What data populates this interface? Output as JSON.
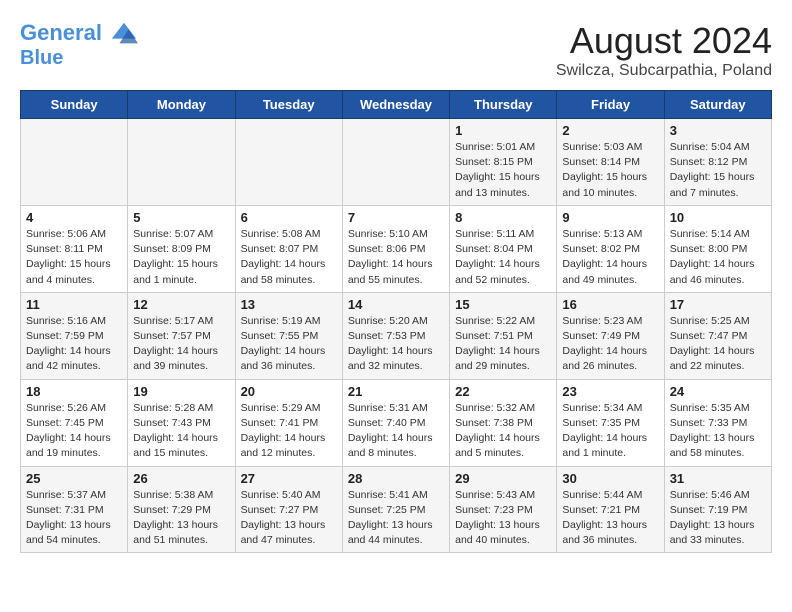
{
  "header": {
    "logo_line1": "General",
    "logo_line2": "Blue",
    "title": "August 2024",
    "subtitle": "Swilcza, Subcarpathia, Poland"
  },
  "days_of_week": [
    "Sunday",
    "Monday",
    "Tuesday",
    "Wednesday",
    "Thursday",
    "Friday",
    "Saturday"
  ],
  "weeks": [
    [
      {
        "day": "",
        "info": ""
      },
      {
        "day": "",
        "info": ""
      },
      {
        "day": "",
        "info": ""
      },
      {
        "day": "",
        "info": ""
      },
      {
        "day": "1",
        "info": "Sunrise: 5:01 AM\nSunset: 8:15 PM\nDaylight: 15 hours\nand 13 minutes."
      },
      {
        "day": "2",
        "info": "Sunrise: 5:03 AM\nSunset: 8:14 PM\nDaylight: 15 hours\nand 10 minutes."
      },
      {
        "day": "3",
        "info": "Sunrise: 5:04 AM\nSunset: 8:12 PM\nDaylight: 15 hours\nand 7 minutes."
      }
    ],
    [
      {
        "day": "4",
        "info": "Sunrise: 5:06 AM\nSunset: 8:11 PM\nDaylight: 15 hours\nand 4 minutes."
      },
      {
        "day": "5",
        "info": "Sunrise: 5:07 AM\nSunset: 8:09 PM\nDaylight: 15 hours\nand 1 minute."
      },
      {
        "day": "6",
        "info": "Sunrise: 5:08 AM\nSunset: 8:07 PM\nDaylight: 14 hours\nand 58 minutes."
      },
      {
        "day": "7",
        "info": "Sunrise: 5:10 AM\nSunset: 8:06 PM\nDaylight: 14 hours\nand 55 minutes."
      },
      {
        "day": "8",
        "info": "Sunrise: 5:11 AM\nSunset: 8:04 PM\nDaylight: 14 hours\nand 52 minutes."
      },
      {
        "day": "9",
        "info": "Sunrise: 5:13 AM\nSunset: 8:02 PM\nDaylight: 14 hours\nand 49 minutes."
      },
      {
        "day": "10",
        "info": "Sunrise: 5:14 AM\nSunset: 8:00 PM\nDaylight: 14 hours\nand 46 minutes."
      }
    ],
    [
      {
        "day": "11",
        "info": "Sunrise: 5:16 AM\nSunset: 7:59 PM\nDaylight: 14 hours\nand 42 minutes."
      },
      {
        "day": "12",
        "info": "Sunrise: 5:17 AM\nSunset: 7:57 PM\nDaylight: 14 hours\nand 39 minutes."
      },
      {
        "day": "13",
        "info": "Sunrise: 5:19 AM\nSunset: 7:55 PM\nDaylight: 14 hours\nand 36 minutes."
      },
      {
        "day": "14",
        "info": "Sunrise: 5:20 AM\nSunset: 7:53 PM\nDaylight: 14 hours\nand 32 minutes."
      },
      {
        "day": "15",
        "info": "Sunrise: 5:22 AM\nSunset: 7:51 PM\nDaylight: 14 hours\nand 29 minutes."
      },
      {
        "day": "16",
        "info": "Sunrise: 5:23 AM\nSunset: 7:49 PM\nDaylight: 14 hours\nand 26 minutes."
      },
      {
        "day": "17",
        "info": "Sunrise: 5:25 AM\nSunset: 7:47 PM\nDaylight: 14 hours\nand 22 minutes."
      }
    ],
    [
      {
        "day": "18",
        "info": "Sunrise: 5:26 AM\nSunset: 7:45 PM\nDaylight: 14 hours\nand 19 minutes."
      },
      {
        "day": "19",
        "info": "Sunrise: 5:28 AM\nSunset: 7:43 PM\nDaylight: 14 hours\nand 15 minutes."
      },
      {
        "day": "20",
        "info": "Sunrise: 5:29 AM\nSunset: 7:41 PM\nDaylight: 14 hours\nand 12 minutes."
      },
      {
        "day": "21",
        "info": "Sunrise: 5:31 AM\nSunset: 7:40 PM\nDaylight: 14 hours\nand 8 minutes."
      },
      {
        "day": "22",
        "info": "Sunrise: 5:32 AM\nSunset: 7:38 PM\nDaylight: 14 hours\nand 5 minutes."
      },
      {
        "day": "23",
        "info": "Sunrise: 5:34 AM\nSunset: 7:35 PM\nDaylight: 14 hours\nand 1 minute."
      },
      {
        "day": "24",
        "info": "Sunrise: 5:35 AM\nSunset: 7:33 PM\nDaylight: 13 hours\nand 58 minutes."
      }
    ],
    [
      {
        "day": "25",
        "info": "Sunrise: 5:37 AM\nSunset: 7:31 PM\nDaylight: 13 hours\nand 54 minutes."
      },
      {
        "day": "26",
        "info": "Sunrise: 5:38 AM\nSunset: 7:29 PM\nDaylight: 13 hours\nand 51 minutes."
      },
      {
        "day": "27",
        "info": "Sunrise: 5:40 AM\nSunset: 7:27 PM\nDaylight: 13 hours\nand 47 minutes."
      },
      {
        "day": "28",
        "info": "Sunrise: 5:41 AM\nSunset: 7:25 PM\nDaylight: 13 hours\nand 44 minutes."
      },
      {
        "day": "29",
        "info": "Sunrise: 5:43 AM\nSunset: 7:23 PM\nDaylight: 13 hours\nand 40 minutes."
      },
      {
        "day": "30",
        "info": "Sunrise: 5:44 AM\nSunset: 7:21 PM\nDaylight: 13 hours\nand 36 minutes."
      },
      {
        "day": "31",
        "info": "Sunrise: 5:46 AM\nSunset: 7:19 PM\nDaylight: 13 hours\nand 33 minutes."
      }
    ]
  ]
}
